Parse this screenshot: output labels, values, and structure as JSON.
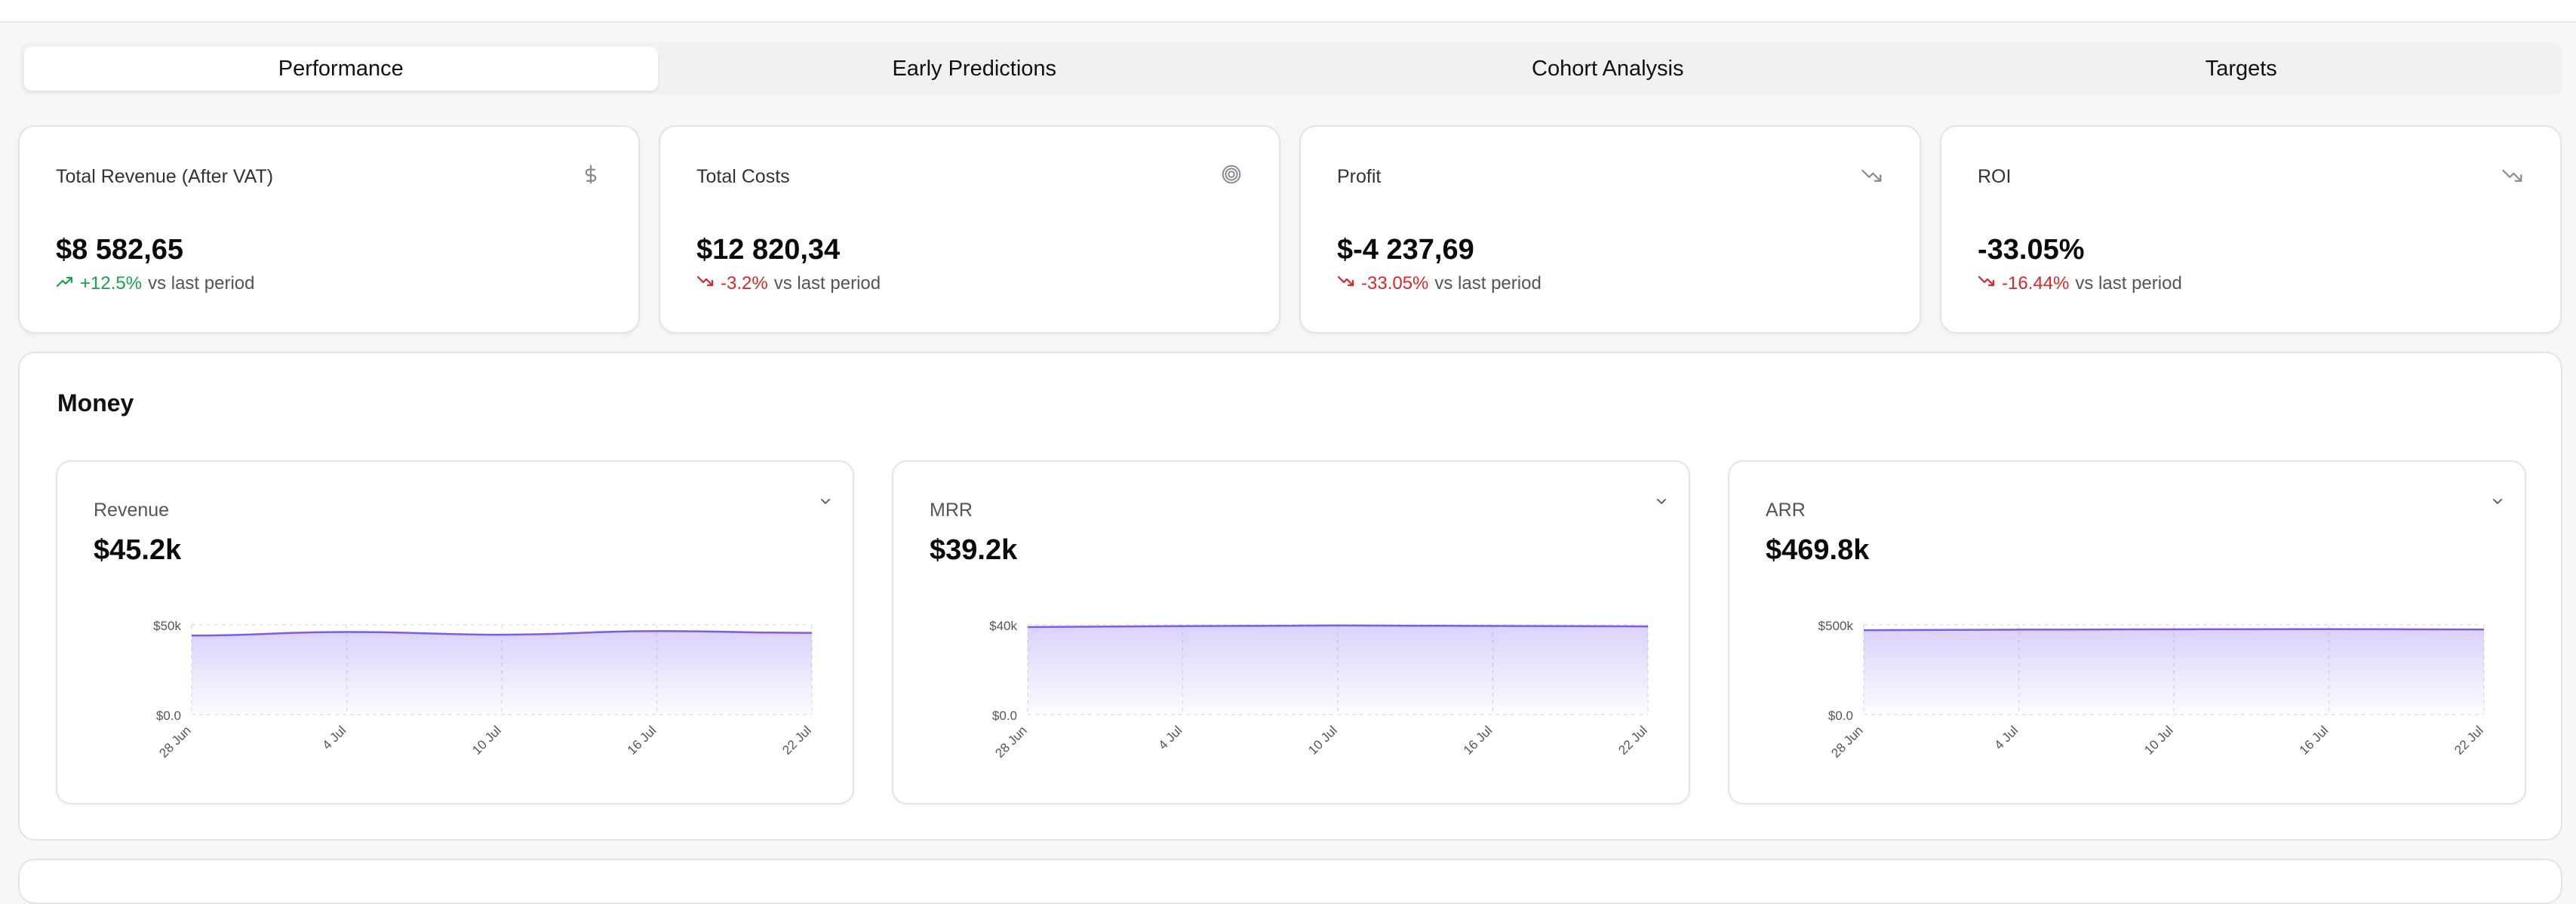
{
  "tabs": [
    {
      "label": "Performance",
      "active": true
    },
    {
      "label": "Early Predictions",
      "active": false
    },
    {
      "label": "Cohort Analysis",
      "active": false
    },
    {
      "label": "Targets",
      "active": false
    }
  ],
  "kpis": [
    {
      "title": "Total Revenue (After VAT)",
      "icon": "dollar-icon",
      "value": "$8 582,65",
      "delta": "+12.5%",
      "direction": "up",
      "suffix": "vs last period"
    },
    {
      "title": "Total Costs",
      "icon": "target-icon",
      "value": "$12 820,34",
      "delta": "-3.2%",
      "direction": "down",
      "suffix": "vs last period"
    },
    {
      "title": "Profit",
      "icon": "trend-down-icon",
      "value": "$-4 237,69",
      "delta": "-33.05%",
      "direction": "down",
      "suffix": "vs last period"
    },
    {
      "title": "ROI",
      "icon": "trend-down-icon",
      "value": "-33.05%",
      "delta": "-16.44%",
      "direction": "down",
      "suffix": "vs last period"
    }
  ],
  "money": {
    "title": "Money",
    "cards": [
      {
        "label": "Revenue",
        "value": "$45.2k"
      },
      {
        "label": "MRR",
        "value": "$39.2k"
      },
      {
        "label": "ARR",
        "value": "$469.8k"
      }
    ]
  },
  "colors": {
    "accent": "#7c5cf0",
    "up": "#16a34a",
    "down": "#dc2626"
  },
  "chart_data": [
    {
      "type": "area",
      "x": [
        "28 Jun",
        "4 Jul",
        "10 Jul",
        "16 Jul",
        "22 Jul"
      ],
      "y_ticks": [
        "$0.0",
        "$50k"
      ],
      "ylim": [
        0,
        50000
      ],
      "series": [
        {
          "values": [
            44000,
            46000,
            44500,
            46500,
            45500
          ]
        }
      ],
      "grid": true
    },
    {
      "type": "area",
      "x": [
        "28 Jun",
        "4 Jul",
        "10 Jul",
        "16 Jul",
        "22 Jul"
      ],
      "y_ticks": [
        "$0.0",
        "$40k"
      ],
      "ylim": [
        0,
        40000
      ],
      "series": [
        {
          "values": [
            39000,
            39400,
            39700,
            39500,
            39300
          ]
        }
      ],
      "grid": true
    },
    {
      "type": "area",
      "x": [
        "28 Jun",
        "4 Jul",
        "10 Jul",
        "16 Jul",
        "22 Jul"
      ],
      "y_ticks": [
        "$0.0",
        "$500k"
      ],
      "ylim": [
        0,
        500000
      ],
      "series": [
        {
          "values": [
            470000,
            473000,
            475000,
            476000,
            474000
          ]
        }
      ],
      "grid": true
    }
  ]
}
